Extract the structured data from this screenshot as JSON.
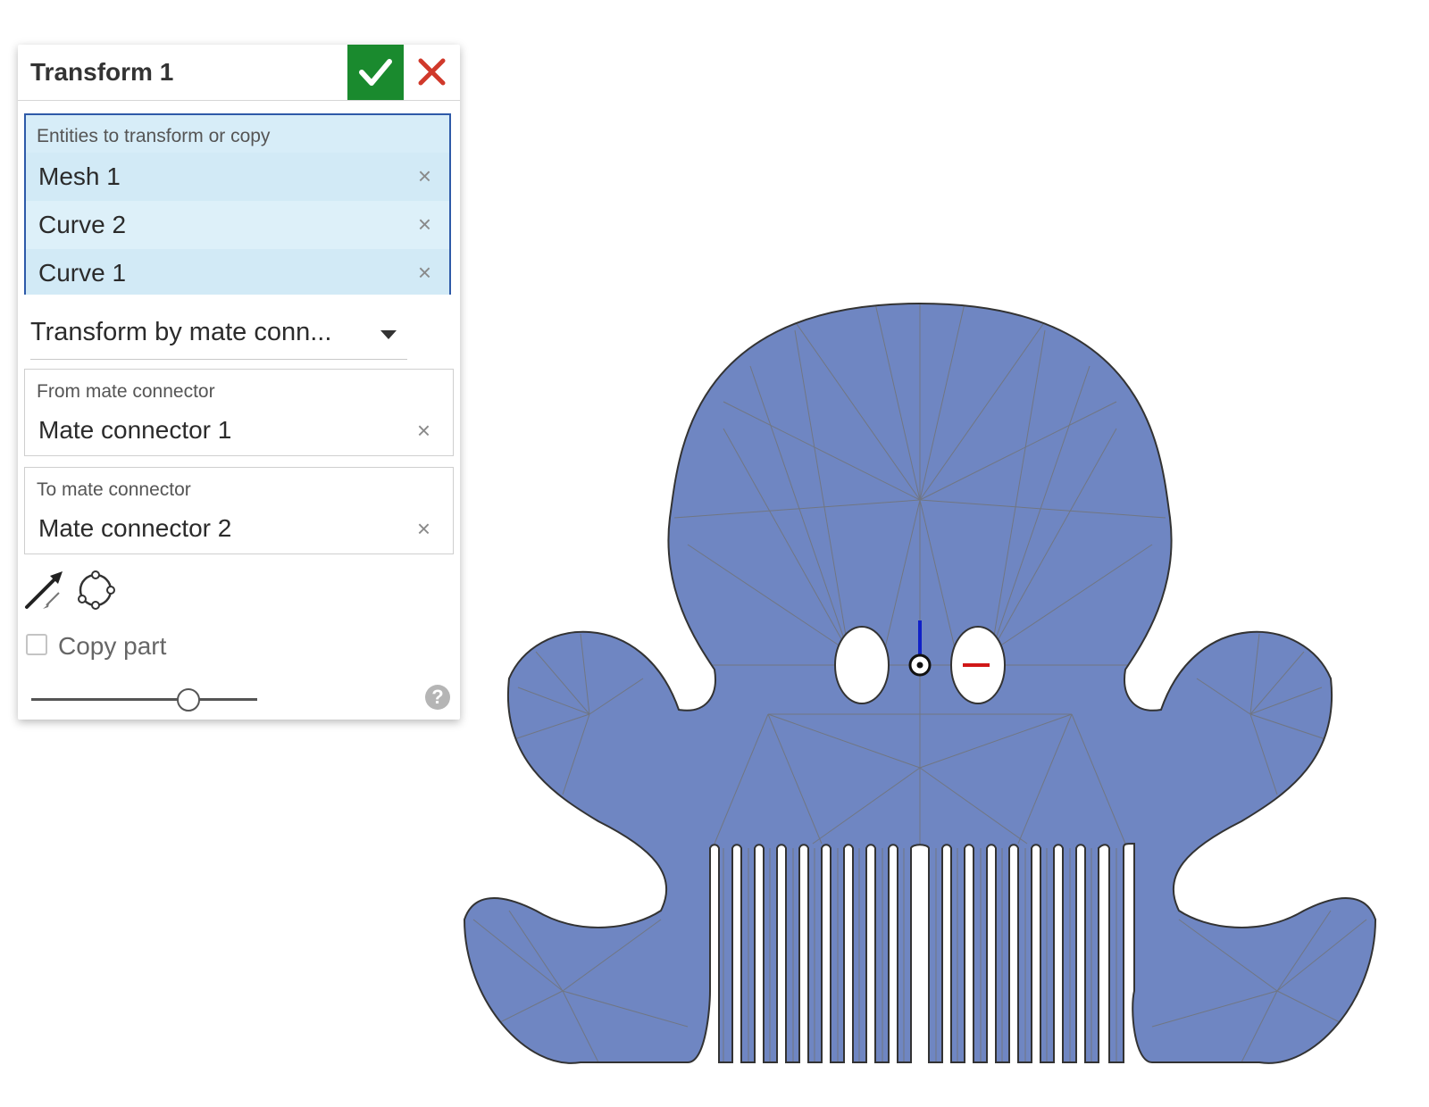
{
  "dialog": {
    "title": "Transform 1",
    "ok_icon": "checkmark-icon",
    "cancel_icon": "close-icon",
    "entities": {
      "label": "Entities to transform or copy",
      "items": [
        {
          "label": "Mesh 1"
        },
        {
          "label": "Curve 2"
        },
        {
          "label": "Curve 1"
        }
      ],
      "remove_glyph": "×"
    },
    "transform_type": {
      "selected": "Transform by mate conn..."
    },
    "from_connector": {
      "label": "From mate connector",
      "value": "Mate connector 1",
      "remove_glyph": "×"
    },
    "to_connector": {
      "label": "To mate connector",
      "value": "Mate connector 2",
      "remove_glyph": "×"
    },
    "tools": {
      "flip_icon": "flip-direction-arrow-icon",
      "rotate_icon": "rotate-cycle-icon"
    },
    "copy_part": {
      "label": "Copy part",
      "checked": false
    },
    "slider": {
      "value_fraction": 0.69
    },
    "help": {
      "glyph": "?"
    }
  },
  "viewport": {
    "model": "octopus-comb-mesh",
    "colors": {
      "mesh_fill": "#6f86c2",
      "mesh_lines": "#717478",
      "outline": "#333333",
      "axis_z": "#1020c8",
      "axis_x": "#d01818",
      "confirm_green": "#1a8a2e",
      "cancel_red": "#d0392b",
      "selection_fill": "#d7edf8",
      "selection_border": "#2e5aa8"
    }
  }
}
